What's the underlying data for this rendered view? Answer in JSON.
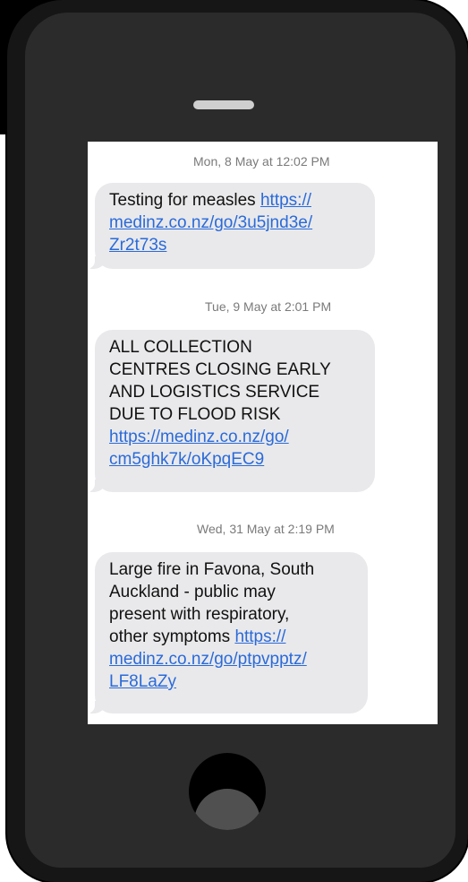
{
  "messages": [
    {
      "timestamp": "Mon, 8 May at 12:02 PM",
      "lines": [
        "Testing for measles "
      ],
      "link_lines": [
        "https://",
        "medinz.co.nz/go/3u5jnd3e/",
        "Zr2t73s"
      ]
    },
    {
      "timestamp": "Tue, 9 May at 2:01 PM",
      "lines": [
        "ALL COLLECTION",
        "CENTRES CLOSING EARLY",
        "AND LOGISTICS SERVICE",
        "DUE TO FLOOD RISK"
      ],
      "link_lines": [
        "https://medinz.co.nz/go/",
        "cm5ghk7k/oKpqEC9"
      ]
    },
    {
      "timestamp": "Wed, 31 May at 2:19 PM",
      "lines": [
        "Large fire in Favona, South",
        "Auckland - public may",
        "present with respiratory,",
        "other symptoms "
      ],
      "link_lines": [
        "https://",
        "medinz.co.nz/go/ptpvpptz/",
        "LF8LaZy"
      ]
    }
  ],
  "colors": {
    "bubble": "#e9e9eb",
    "link": "#2a6ad9",
    "timestamp": "#7a7a7a",
    "phone_body": "#161616"
  }
}
